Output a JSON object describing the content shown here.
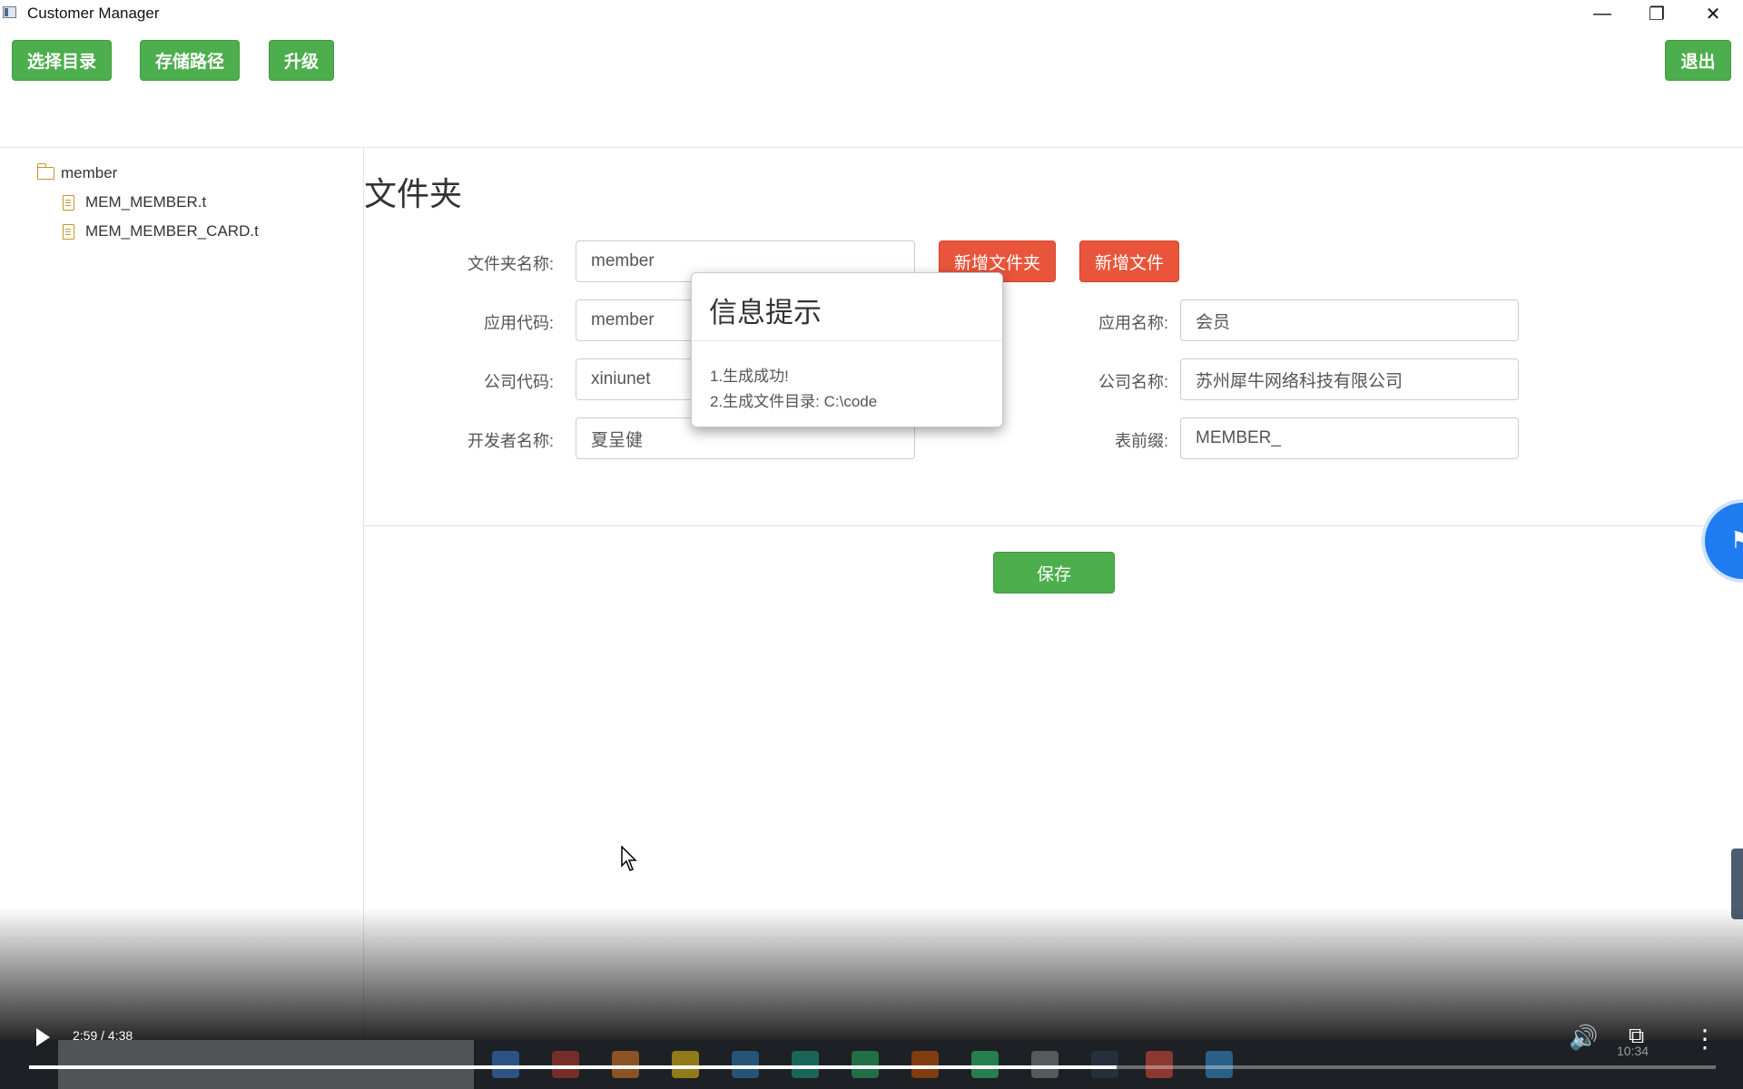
{
  "window": {
    "title": "Customer Manager"
  },
  "toolbar": {
    "select_dir": "选择目录",
    "storage_path": "存储路径",
    "upgrade": "升级",
    "exit": "退出"
  },
  "tree": {
    "folder": "member",
    "files": [
      "MEM_MEMBER.t",
      "MEM_MEMBER_CARD.t"
    ]
  },
  "form": {
    "section_title": "文件夹",
    "folder_name_label": "文件夹名称:",
    "folder_name_value": "member",
    "add_folder": "新增文件夹",
    "add_file": "新增文件",
    "app_code_label": "应用代码:",
    "app_code_value": "member",
    "app_name_label": "应用名称:",
    "app_name_value": "会员",
    "company_code_label": "公司代码:",
    "company_code_value": "xiniunet",
    "company_name_label": "公司名称:",
    "company_name_value": "苏州犀牛网络科技有限公司",
    "developer_label": "开发者名称:",
    "developer_value": "夏呈健",
    "table_prefix_label": "表前缀:",
    "table_prefix_value": "MEMBER_",
    "save": "保存"
  },
  "dialog": {
    "title": "信息提示",
    "line1": "1.生成成功!",
    "line2": "2.生成文件目录: C:\\code"
  },
  "video": {
    "time": "2:59 / 4:38",
    "progress": 0.645
  },
  "taskbar": {
    "clock": "10:34"
  },
  "colors": {
    "primary_green": "#4cae4c",
    "danger_red": "#e8553b"
  }
}
